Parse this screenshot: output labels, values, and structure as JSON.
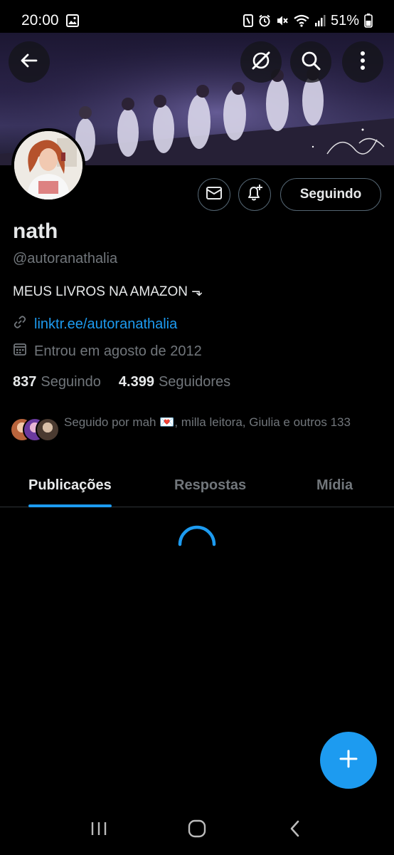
{
  "status_bar": {
    "time": "20:00",
    "battery": "51%"
  },
  "profile": {
    "name": "nath",
    "handle": "@autoranathalia",
    "bio": "MEUS LIVROS NA AMAZON ⬎",
    "link": "linktr.ee/autoranathalia",
    "joined": "Entrou em agosto de 2012",
    "following_count": "837",
    "following_label": "Seguindo",
    "followers_count": "4.399",
    "followers_label": "Seguidores",
    "followed_by": "Seguido por mah 💌, milla leitora, Giulia e outros 133"
  },
  "actions": {
    "following_button": "Seguindo"
  },
  "tabs": [
    {
      "label": "Publicações",
      "active": true
    },
    {
      "label": "Respostas",
      "active": false
    },
    {
      "label": "Mídia",
      "active": false
    }
  ],
  "icons": {
    "back": "arrow-left-icon",
    "grok": "grok-icon",
    "search": "search-icon",
    "more": "more-vertical-icon",
    "message": "envelope-icon",
    "notify": "bell-plus-icon",
    "link": "link-icon",
    "calendar": "calendar-icon",
    "compose": "plus-icon"
  },
  "colors": {
    "accent": "#1d9bf0",
    "background": "#000000",
    "muted": "#71767b"
  }
}
